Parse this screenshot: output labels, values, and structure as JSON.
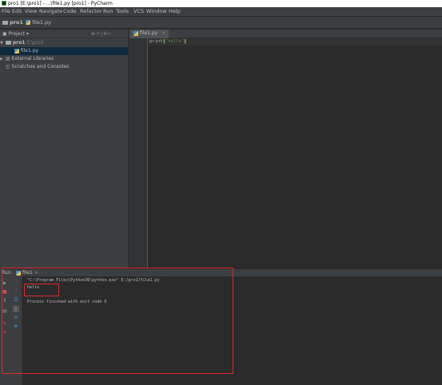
{
  "window": {
    "title": "pro1 [E:\\pro1] - ...\\file1.py [pro1] - PyCharm"
  },
  "menu": [
    "File",
    "Edit",
    "View",
    "Navigate",
    "Code",
    "Refactor",
    "Run",
    "Tools",
    "VCS",
    "Window",
    "Help"
  ],
  "breadcrumbs": [
    "pro1",
    "file1.py"
  ],
  "project_panel": {
    "header": "Project",
    "tree": [
      {
        "name": "pro1",
        "extra": "E:\\pro1",
        "kind": "folder",
        "expanded": true
      },
      {
        "name": "file1.py",
        "kind": "python-file",
        "selected": true
      },
      {
        "name": "External Libraries",
        "kind": "libraries"
      },
      {
        "name": "Scratches and Consoles",
        "kind": "scratches"
      }
    ]
  },
  "editor": {
    "tab": "file1.py",
    "code": {
      "func": "print",
      "open": "(",
      "string": "'hello'",
      "close": ")"
    }
  },
  "run": {
    "label": "Run:",
    "tab": "file1",
    "command": "\"C:\\Program Files\\Python36\\python.exe\" E:/pro1/file1.py",
    "output": "hello",
    "finished": "Process finished with exit code 0"
  },
  "colors": {
    "highlight": "#e0262d",
    "selection": "#0d293e",
    "string": "#6a8759",
    "run_green": "#59a869",
    "stop_red": "#c75450"
  }
}
